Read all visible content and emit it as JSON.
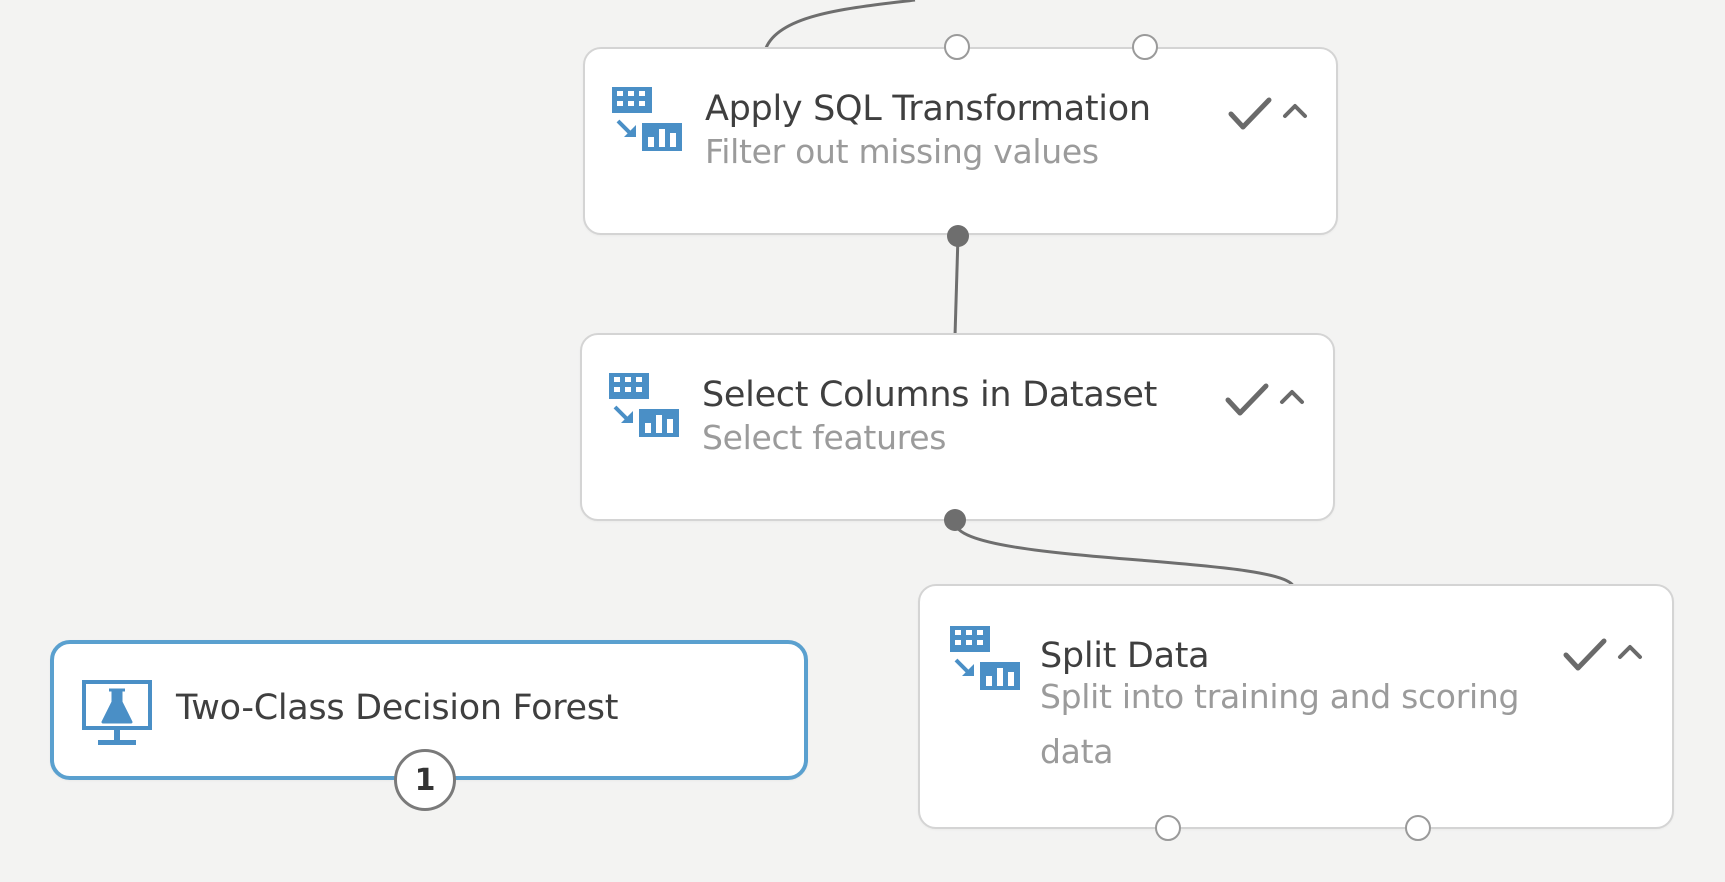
{
  "canvas": {
    "nodes": [
      {
        "id": "apply-sql",
        "title": "Apply SQL Transformation",
        "subtitle": "Filter out missing values",
        "icon": "data-transform-icon",
        "status": "completed",
        "status_icon": "checkmark-icon",
        "collapse_icon": "chevron-up-icon"
      },
      {
        "id": "select-columns",
        "title": "Select Columns in Dataset",
        "subtitle": "Select features",
        "icon": "data-transform-icon",
        "status": "completed",
        "status_icon": "checkmark-icon",
        "collapse_icon": "chevron-up-icon"
      },
      {
        "id": "split-data",
        "title": "Split Data",
        "subtitle_lines": [
          "Split into training and scoring",
          "data"
        ],
        "icon": "data-transform-icon",
        "status": "completed",
        "status_icon": "checkmark-icon",
        "collapse_icon": "chevron-up-icon"
      },
      {
        "id": "two-class-forest",
        "title": "Two-Class Decision Forest",
        "icon": "model-flask-icon",
        "badge": "1",
        "selected": true
      }
    ],
    "colors": {
      "canvas_background": "#f3f3f2",
      "node_border": "#d4d4d4",
      "selected_border": "#5aa0cf",
      "icon_blue": "#4a8fc6",
      "title_text": "#3f3f3f",
      "subtitle_text": "#9b9b9b",
      "connector": "#6e6e6e"
    }
  }
}
